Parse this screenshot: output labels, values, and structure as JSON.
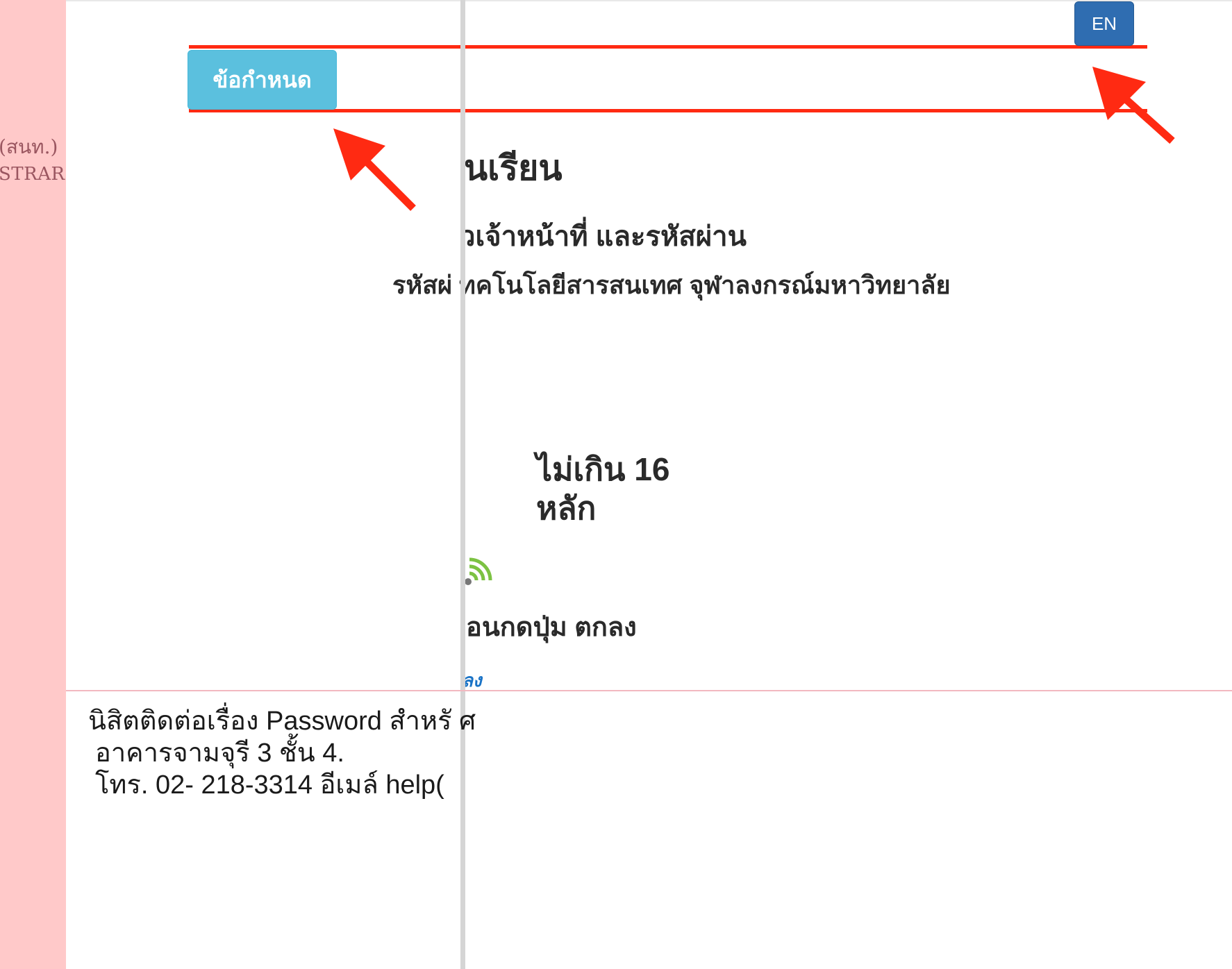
{
  "sidebar": {
    "line1": "(สนท.)",
    "line2": "STRAR"
  },
  "header": {
    "lang_button": "EN",
    "terms_button": "ข้อกำหนด"
  },
  "main": {
    "title": "นเรียน",
    "subtitle": "วเจ้าหน้าที่  และรหัสผ่าน",
    "line3": "รหัสผ่ ทคโนโลยีสารสนเทศ จุฬาลงกรณ์มหาวิทยาลัย",
    "limit_line1": "ไม่เกิน 16",
    "limit_line2": "หลัก",
    "press_text": "อนกดปุ่ม ตกลง",
    "link_text": "ลง"
  },
  "footer": {
    "line1": "นิสิตติดต่อเรื่อง Password สำหรั ศ",
    "line2": "อาคารจามจุรี 3 ชั้น 4.",
    "line3": "โทร. 02- 218-3314 อีเมล์ help("
  },
  "colors": {
    "sidebar_bg": "#ffc9c9",
    "lang_button_bg": "#2f6db1",
    "terms_button_bg": "#5bc0de",
    "annotation_red": "#ff2a12"
  },
  "icons": [
    "wifi-signal-icon",
    "annotation-arrow-icon"
  ]
}
